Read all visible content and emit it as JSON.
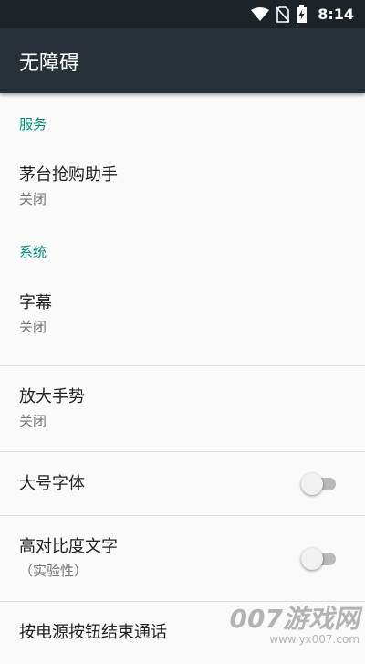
{
  "status_bar": {
    "time": "8:14",
    "icons": [
      "wifi-icon",
      "no-sim-icon",
      "battery-charging-icon"
    ]
  },
  "app_bar": {
    "title": "无障碍"
  },
  "sections": {
    "services": {
      "header": "服务",
      "items": [
        {
          "title": "茅台抢购助手",
          "summary": "关闭"
        }
      ]
    },
    "system": {
      "header": "系统",
      "items": [
        {
          "title": "字幕",
          "summary": "关闭"
        },
        {
          "title": "放大手势",
          "summary": "关闭"
        },
        {
          "title": "大号字体",
          "switch_on": false
        },
        {
          "title": "高对比度文字",
          "summary": "（实验性）",
          "switch_on": false
        },
        {
          "title": "按电源按钮结束通话"
        }
      ]
    }
  },
  "watermark": {
    "main": "007游戏网",
    "sub": "www.yx007.com"
  },
  "colors": {
    "status_bar": "#1c2429",
    "app_bar": "#263238",
    "accent": "#00897b",
    "background": "#fafafa"
  }
}
